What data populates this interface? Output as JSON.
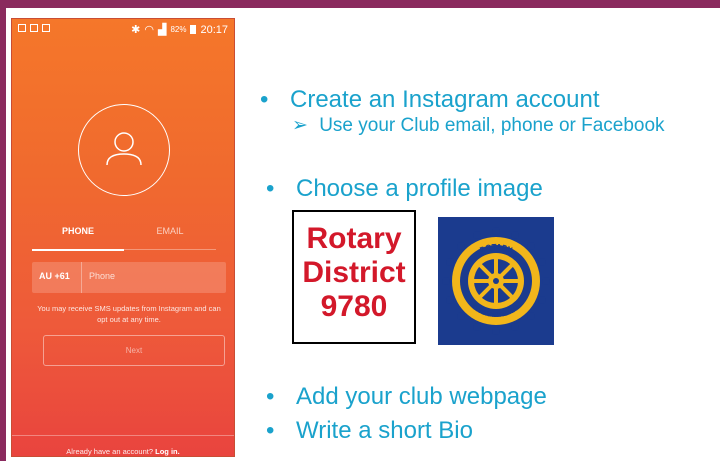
{
  "phone": {
    "status_time": "20:17",
    "battery": "82%",
    "tabs": {
      "phone": "PHONE",
      "email": "EMAIL"
    },
    "country_code": "AU +61",
    "phone_placeholder": "Phone",
    "sms_note": "You may receive SMS updates from Instagram and can opt out at any time.",
    "next_label": "Next",
    "login_prompt": "Already have an account?",
    "login_link": "Log in."
  },
  "bullets": {
    "b1": "Create an Instagram account",
    "b1_sub": "Use your Club email, phone or Facebook",
    "b2": "Choose a profile image",
    "b3": "Add your club webpage",
    "b4": "Write a short Bio"
  },
  "logos": {
    "district_lines": [
      "Rotary",
      "District",
      "9780"
    ],
    "emblem_text_top": "ROTARY",
    "emblem_text_bottom": "INTERNATIONAL"
  },
  "colors": {
    "frame": "#8a2a5e",
    "bullet_text": "#1aa2cc",
    "district_red": "#d3182a",
    "emblem_blue": "#1b3b8e",
    "emblem_gold": "#f2b61b"
  }
}
